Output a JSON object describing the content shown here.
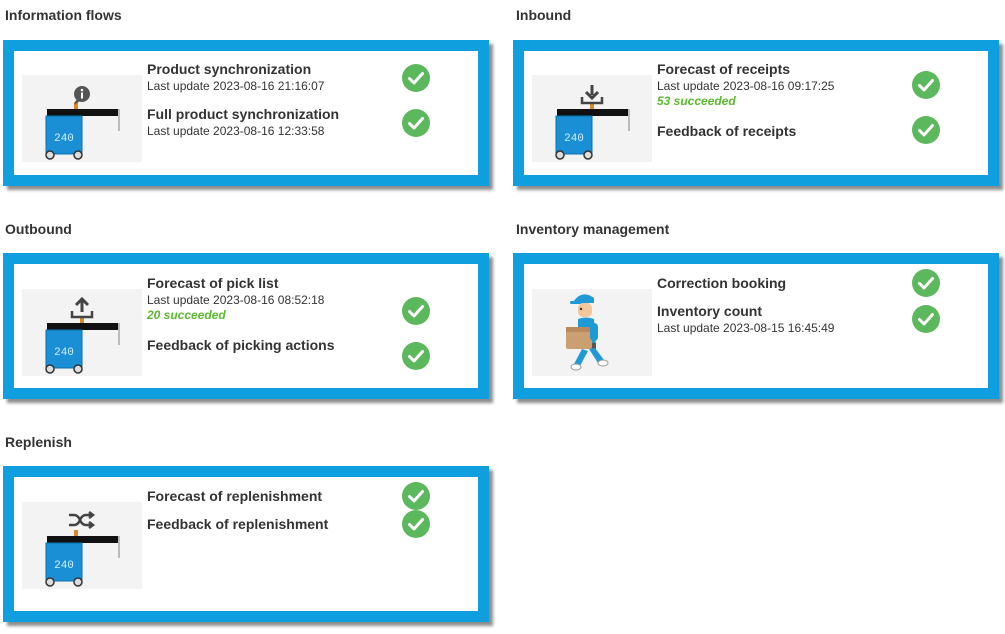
{
  "sections": [
    {
      "title": "Information flows",
      "items": [
        {
          "title": "Product synchronization",
          "sub": "Last update 2023-08-16 21:16:07"
        },
        {
          "title": "Full product synchronization",
          "sub": "Last update 2023-08-16 12:33:58"
        }
      ],
      "robot_display": "240",
      "robot_icon": "info-icon"
    },
    {
      "title": "Inbound",
      "items": [
        {
          "title": "Forecast of receipts",
          "sub": "Last update 2023-08-16 09:17:25",
          "success": "53 succeeded"
        },
        {
          "title": "Feedback of receipts"
        }
      ],
      "robot_display": "240",
      "robot_icon": "download-icon"
    },
    {
      "title": "Outbound",
      "items": [
        {
          "title": "Forecast of pick list",
          "sub": "Last update 2023-08-16 08:52:18",
          "success": "20 succeeded"
        },
        {
          "title": "Feedback of picking actions"
        }
      ],
      "robot_display": "240",
      "robot_icon": "upload-icon"
    },
    {
      "title": "Inventory management",
      "items": [
        {
          "title": "Correction booking"
        },
        {
          "title": "Inventory count",
          "sub": "Last update 2023-08-15 16:45:49"
        }
      ],
      "thumb_icon": "delivery-worker-icon"
    },
    {
      "title": "Replenish",
      "items": [
        {
          "title": "Forecast of replenishment"
        },
        {
          "title": "Feedback of replenishment"
        }
      ],
      "robot_display": "240",
      "robot_icon": "shuffle-icon"
    }
  ],
  "colors": {
    "card_border": "#0f9fdf",
    "success_green": "#5cb82e",
    "check_green": "#5cb85c",
    "robot_blue": "#1a8fd6"
  }
}
